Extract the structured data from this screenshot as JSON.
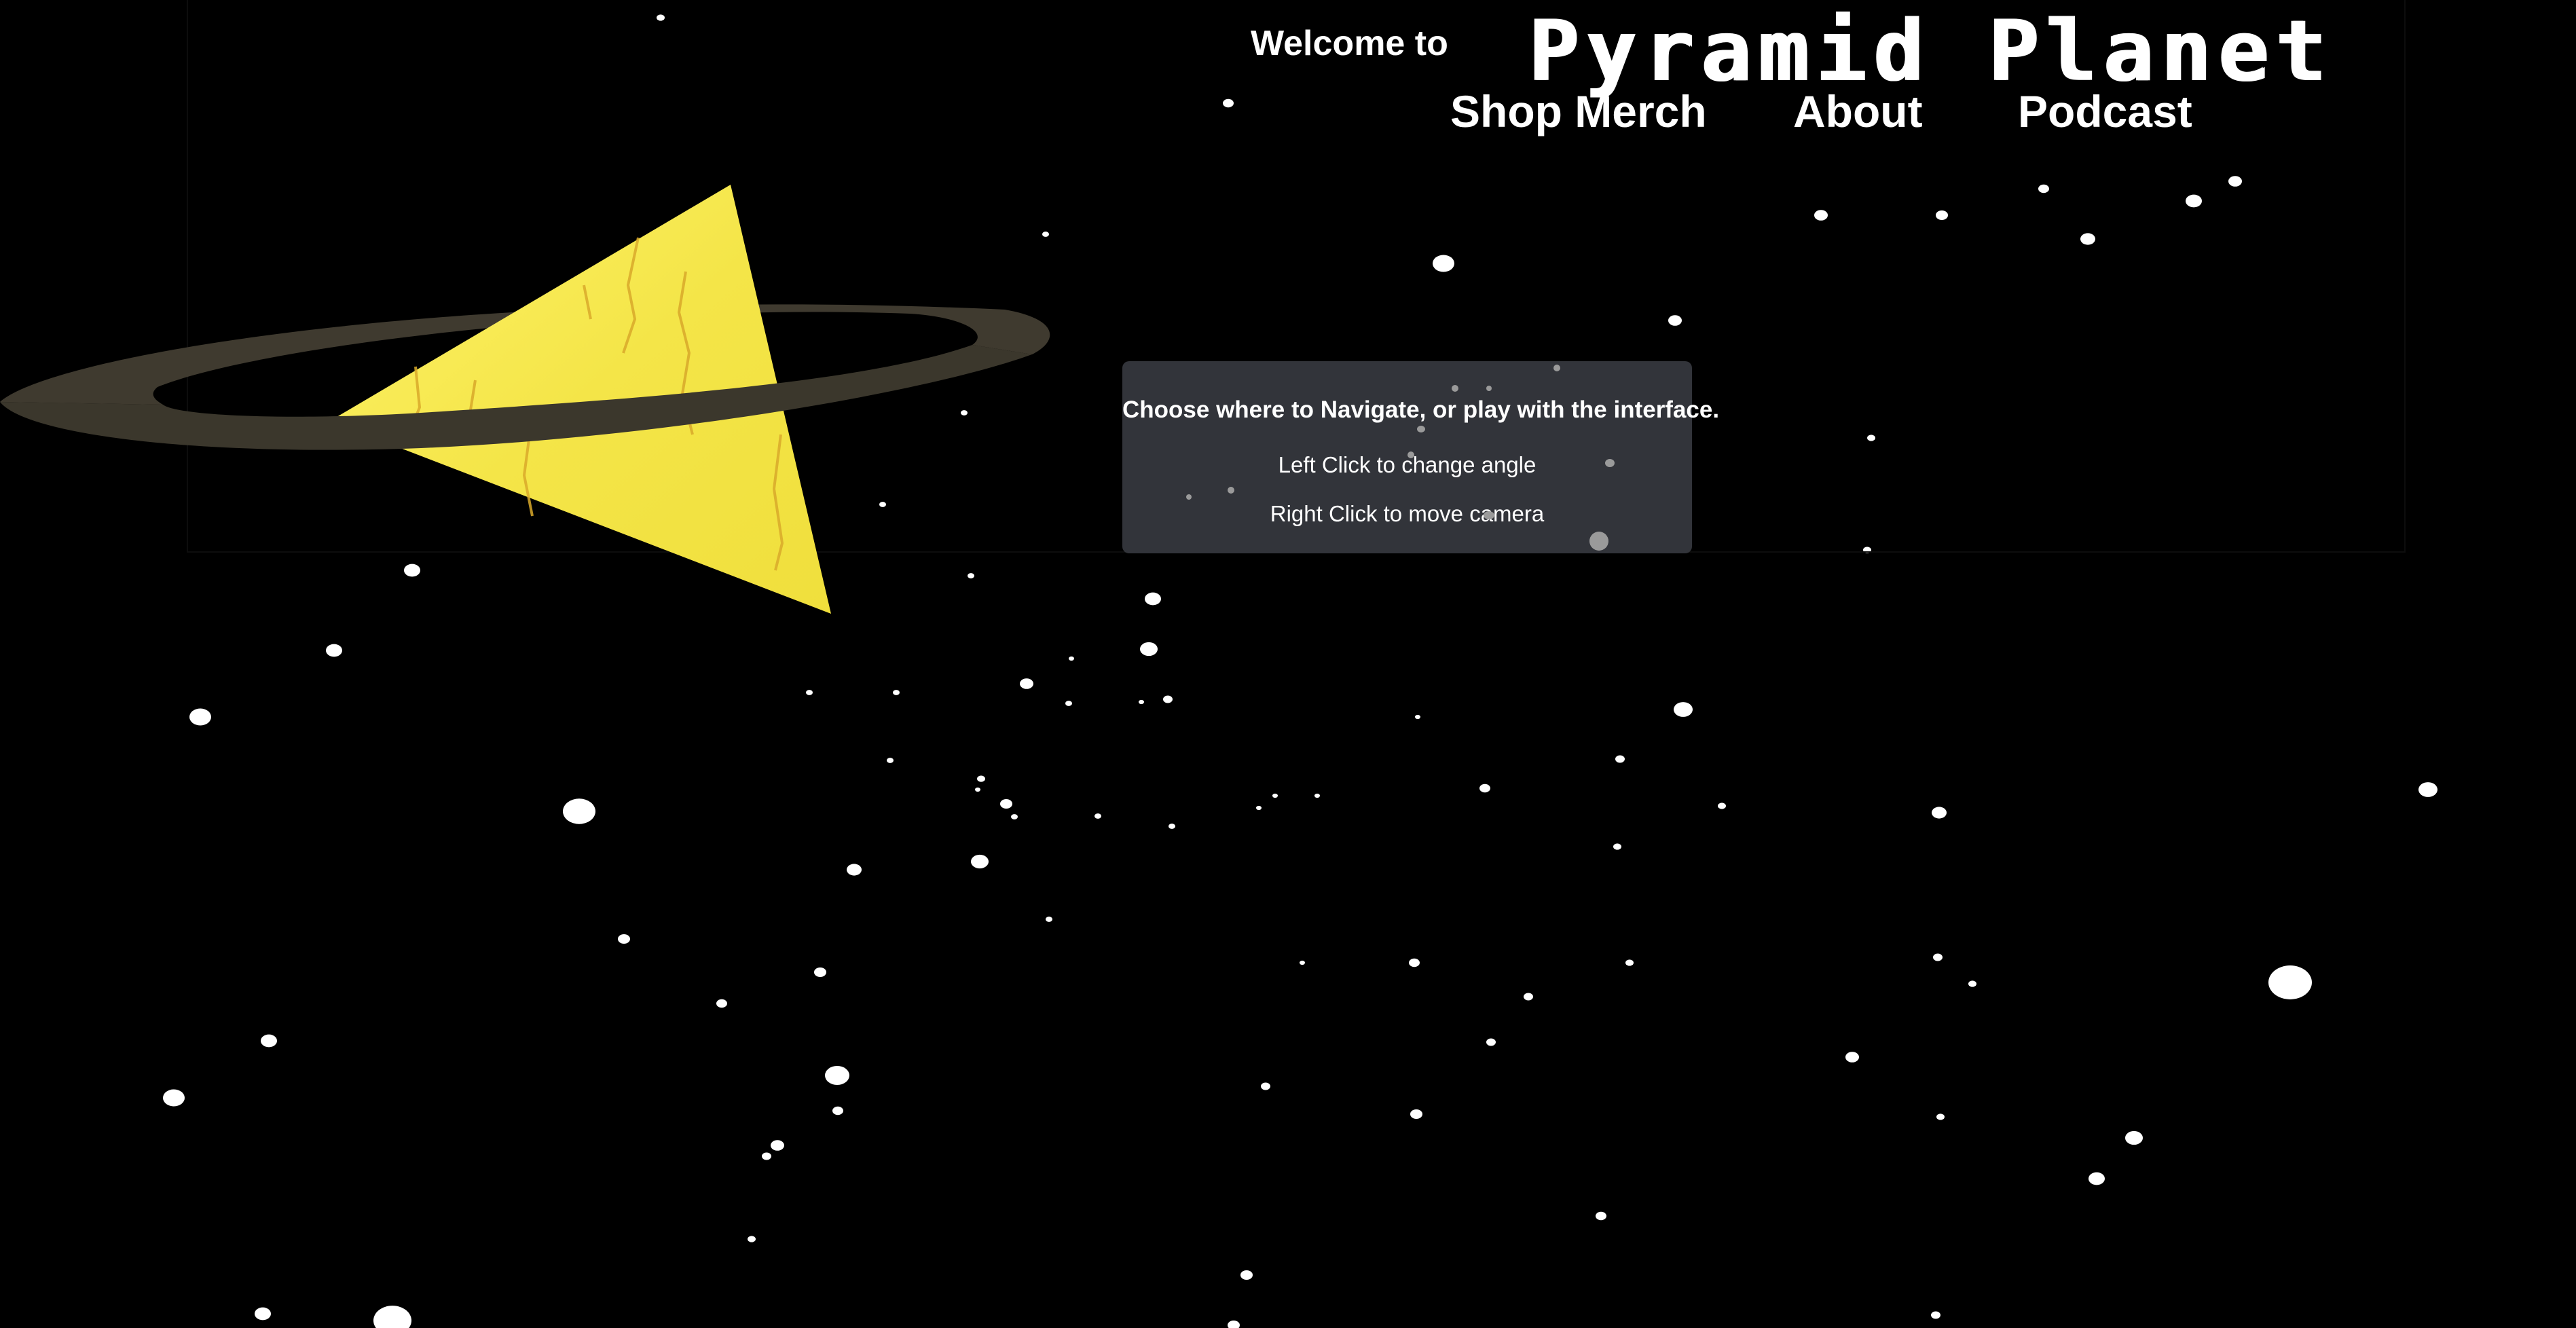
{
  "header": {
    "welcome": "Welcome to",
    "title": "Pyramid Planet"
  },
  "nav": {
    "shop": "Shop Merch",
    "about": "About",
    "podcast": "Podcast"
  },
  "panel": {
    "title": "Choose where to Navigate, or play with the interface.",
    "line1": "Left Click to change angle",
    "line2": "Right Click to move camera"
  },
  "colors": {
    "background": "#000000",
    "pyramid": "#f5e84a",
    "ring": "#403b30",
    "panel": "#34363c",
    "text": "#ffffff"
  }
}
